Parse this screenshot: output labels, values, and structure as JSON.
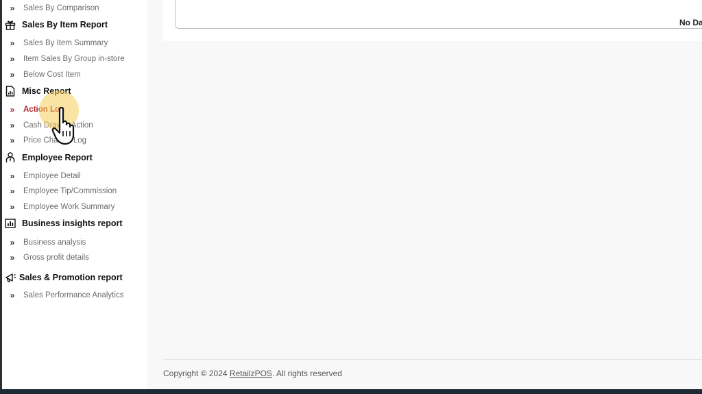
{
  "sidebar": {
    "items": [
      {
        "label": "Sales By Comparison"
      },
      {
        "label": "Sales By Item Report"
      },
      {
        "label": "Sales By Item Summary"
      },
      {
        "label": "Item Sales By Group in-store"
      },
      {
        "label": "Below Cost Item"
      },
      {
        "label": "Misc Report"
      },
      {
        "label": "Action Log"
      },
      {
        "label": "Cash Drawer Action"
      },
      {
        "label": "Price Change Log"
      },
      {
        "label": "Employee Report"
      },
      {
        "label": "Employee Detail"
      },
      {
        "label": "Employee Tip/Commission"
      },
      {
        "label": "Employee Work Summary"
      },
      {
        "label": "Business insights report"
      },
      {
        "label": "Business analysis"
      },
      {
        "label": "Gross profit details"
      },
      {
        "label": "Sales & Promotion report"
      },
      {
        "label": "Sales Performance Analytics"
      }
    ]
  },
  "main": {
    "no_data_text": "No Data Avai"
  },
  "footer": {
    "prefix": "Copyright © 2024 ",
    "brand": "RetailzPOS",
    "suffix": ". All rights reserved"
  },
  "colors": {
    "active": "#b0252c",
    "highlight": "#f5cd5a"
  }
}
